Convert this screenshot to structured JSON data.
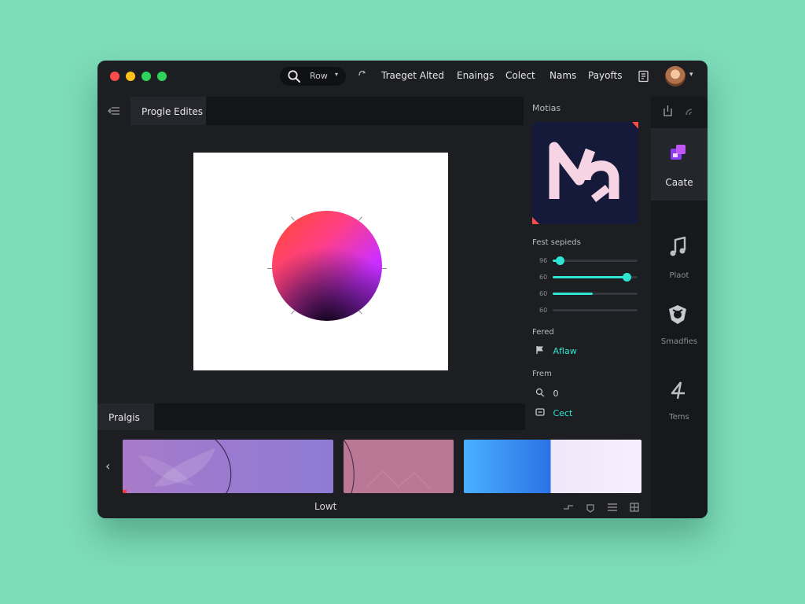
{
  "titlebar": {
    "window_dot_colors": [
      "#ff4b4b",
      "#ffc21a",
      "#2fd25a",
      "#2fd25a"
    ],
    "search": {
      "label": "Row",
      "icon": "search-icon"
    },
    "nav": [
      "Traeget Alted",
      "Enaings",
      "Colect",
      "Nams",
      "Payofts"
    ],
    "icons": [
      "cursor-icon",
      "document-icon",
      "avatar"
    ]
  },
  "editor": {
    "tab_label": "Progle Edites",
    "panel_label": "Pralgis"
  },
  "bottom_bar": {
    "label": "Lowt",
    "icons": [
      "crop-icon",
      "gem-icon",
      "menu-icon",
      "grid-icon"
    ]
  },
  "properties": {
    "title": "Motias",
    "sliders_title": "Fest sepieds",
    "sliders": [
      {
        "label": "96",
        "value": 0.08,
        "knob": true
      },
      {
        "label": "60",
        "value": 0.87,
        "knob": true
      },
      {
        "label": "60",
        "value": 0.47,
        "knob": false
      },
      {
        "label": "60",
        "value": 0.0,
        "knob": false
      }
    ],
    "fered_label": "Fered",
    "fered_value": "Aflaw",
    "frem_label": "Frem",
    "frem_rows": [
      {
        "icon": "link-icon",
        "value": "0"
      },
      {
        "icon": "frame-icon",
        "value": "Cect"
      }
    ],
    "accent_color": "#2ee4d2"
  },
  "rail": {
    "items": [
      {
        "label": "Caate",
        "icon": "layers-icon",
        "active": true
      },
      {
        "label": "Plaot",
        "icon": "music-note-icon",
        "active": false
      },
      {
        "label": "Smadfies",
        "icon": "shield-icon",
        "active": false
      },
      {
        "label": "Tems",
        "icon": "number-four-icon",
        "active": false
      }
    ]
  }
}
